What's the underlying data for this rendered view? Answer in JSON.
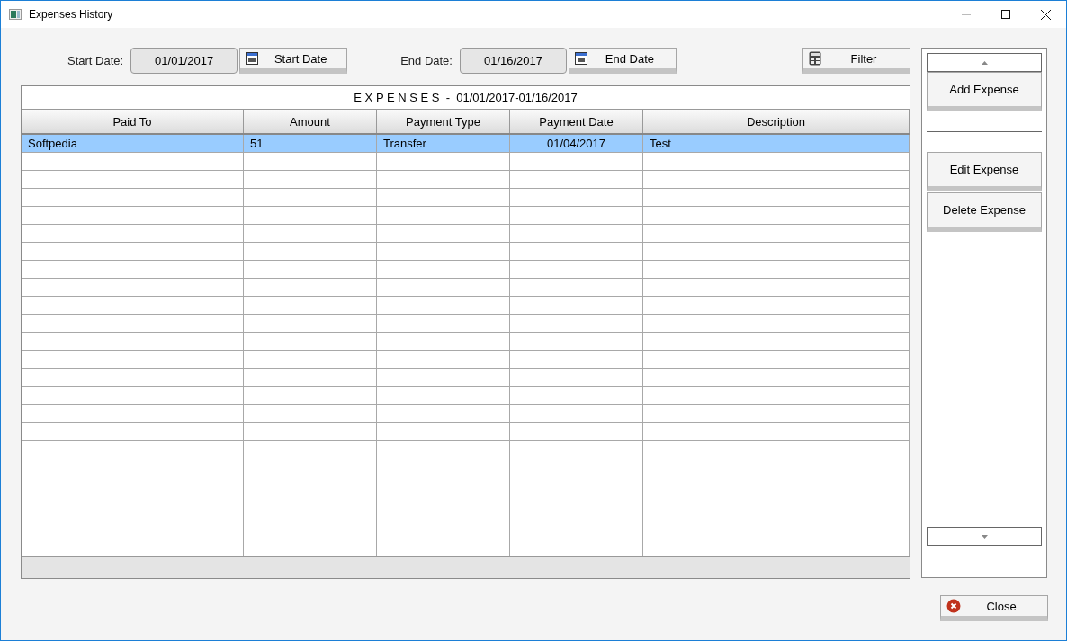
{
  "window": {
    "title": "Expenses History"
  },
  "filters": [
    {
      "label": "Start Date:",
      "value": "01/01/2017",
      "button": "Start Date"
    },
    {
      "label": "End Date:",
      "value": "01/16/2017",
      "button": "End Date"
    }
  ],
  "filter_button": "Filter",
  "table": {
    "title": "E X P E N S E S  -  01/01/2017-01/16/2017",
    "columns": [
      "Paid To",
      "Amount",
      "Payment Type",
      "Payment Date",
      "Description"
    ],
    "rows": [
      {
        "cells": [
          "Softpedia",
          "51",
          "Transfer",
          "01/04/2017",
          "Test"
        ],
        "selected": true
      }
    ]
  },
  "side_panel": {
    "groups": [
      [
        "Add Expense"
      ],
      [
        "Edit Expense",
        "Delete Expense"
      ]
    ]
  },
  "close_button": "Close"
}
